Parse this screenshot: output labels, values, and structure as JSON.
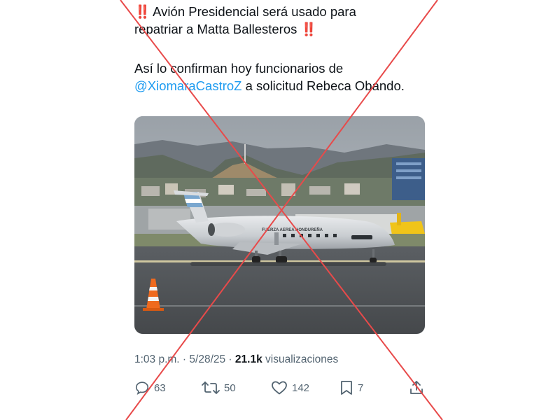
{
  "tweet": {
    "line1_emoji_start": "‼️",
    "line1_text": "Avión  Presidencial será usado para",
    "line2_text": "repatriar a Matta Ballesteros",
    "line2_emoji_end": "‼️",
    "line3_text": "Así lo confirman hoy funcionarios de",
    "mention": "@XiomaraCastroZ",
    "line4_rest": " a solicitud Rebeca Obando.",
    "aircraft_livery": "FUERZA AEREA HONDUREÑA"
  },
  "meta": {
    "time": "1:03 p.m.",
    "separator": " · ",
    "date": "5/28/25",
    "views_count": "21.1k",
    "views_label": "visualizaciones"
  },
  "actions": {
    "replies": "63",
    "reposts": "50",
    "likes": "142",
    "bookmarks": "7"
  },
  "colors": {
    "mention": "#1d9bf0",
    "emoji_red": "#e0202a",
    "cross_red": "#e84a4a",
    "secondary_text": "#536471"
  },
  "icons": {
    "reply": "speech-bubble-icon",
    "repost": "repost-arrows-icon",
    "like": "heart-icon",
    "bookmark": "bookmark-icon",
    "share": "share-upload-icon"
  }
}
